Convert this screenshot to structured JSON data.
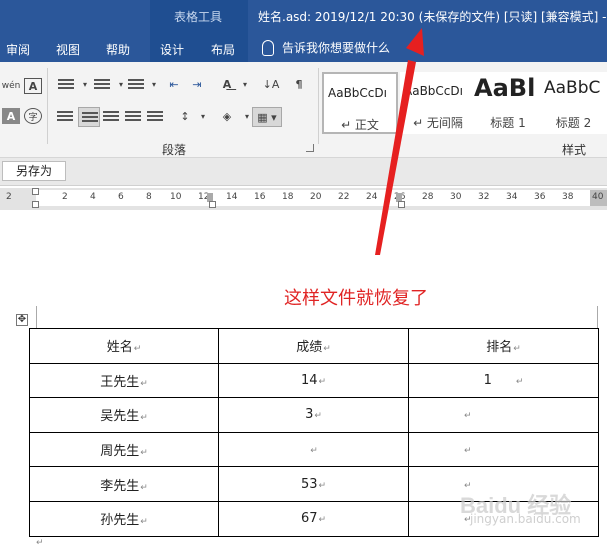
{
  "titlebar": {
    "context_tool": "表格工具",
    "document_title": "姓名.asd: 2019/12/1 20:30 (未保存的文件) [只读] [兼容模式] -"
  },
  "tabs": [
    {
      "label": "审阅"
    },
    {
      "label": "视图"
    },
    {
      "label": "帮助"
    },
    {
      "label": "设计"
    },
    {
      "label": "布局"
    }
  ],
  "tell_me": "告诉我你想要做什么",
  "ribbon": {
    "paragraph_group": "段落",
    "styles_group": "样式",
    "styles": [
      {
        "preview": "AaBbCcDı",
        "name": "↵ 正文"
      },
      {
        "preview": "AaBbCcDı",
        "name": "↵ 无间隔"
      },
      {
        "preview": "AaBl",
        "name": "标题 1"
      },
      {
        "preview": "AaBbC",
        "name": "标题 2"
      }
    ]
  },
  "save_as_button": "另存为",
  "ruler": {
    "ticks": [
      "2",
      "2",
      "4",
      "6",
      "8",
      "10",
      "12",
      "14",
      "16",
      "18",
      "20",
      "22",
      "24",
      "26",
      "28",
      "30",
      "32",
      "34",
      "36",
      "38",
      "40"
    ]
  },
  "annotation": "这样文件就恢复了",
  "table": {
    "headers": [
      "姓名",
      "成绩",
      "排名"
    ],
    "rows": [
      [
        "王先生",
        "14",
        "1"
      ],
      [
        "吴先生",
        "3",
        ""
      ],
      [
        "周先生",
        "",
        ""
      ],
      [
        "李先生",
        "53",
        ""
      ],
      [
        "孙先生",
        "67",
        ""
      ]
    ]
  },
  "paragraph_mark": "↵",
  "watermark": "Baidu 经验",
  "watermark_sub": "jingyan.baidu.com"
}
